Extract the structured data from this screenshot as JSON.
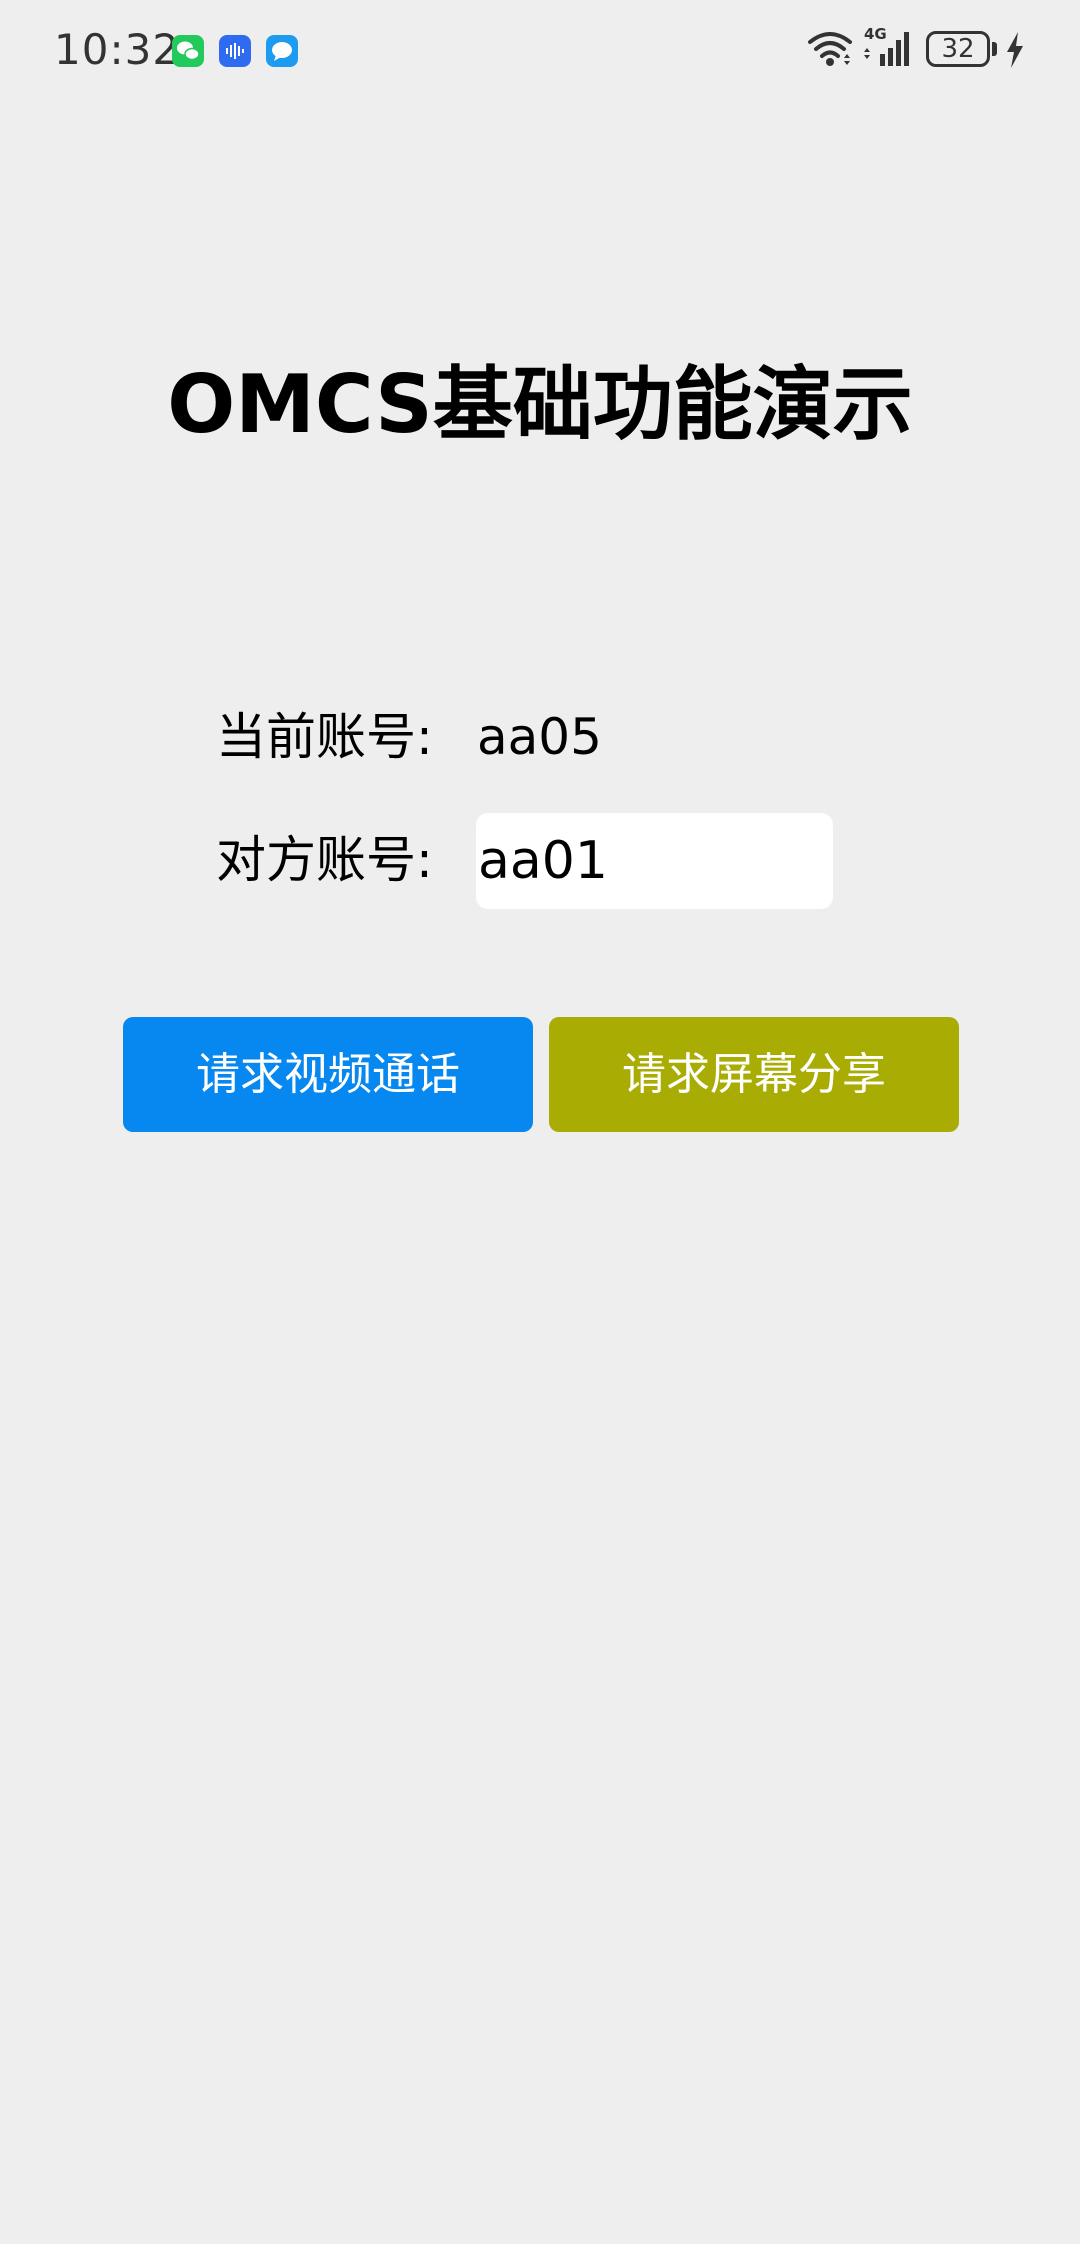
{
  "status_bar": {
    "time": "10:32",
    "network": "4G",
    "battery": "32",
    "notification_icons": [
      "wechat-icon",
      "voice-icon",
      "message-icon"
    ],
    "system_icons": [
      "wifi-icon",
      "signal-icon",
      "battery-icon",
      "charging-icon"
    ]
  },
  "main": {
    "title": "OMCS基础功能演示",
    "current_account_label": "当前账号:",
    "current_account_value": "aa05",
    "target_account_label": "对方账号:",
    "target_account_value": "aa01"
  },
  "actions": {
    "video_call_label": "请求视频通话",
    "screen_share_label": "请求屏幕分享"
  },
  "colors": {
    "background": "#eeeeee",
    "video_button": "#0787f0",
    "screen_button": "#a8ac03",
    "input_background": "#ffffff"
  }
}
